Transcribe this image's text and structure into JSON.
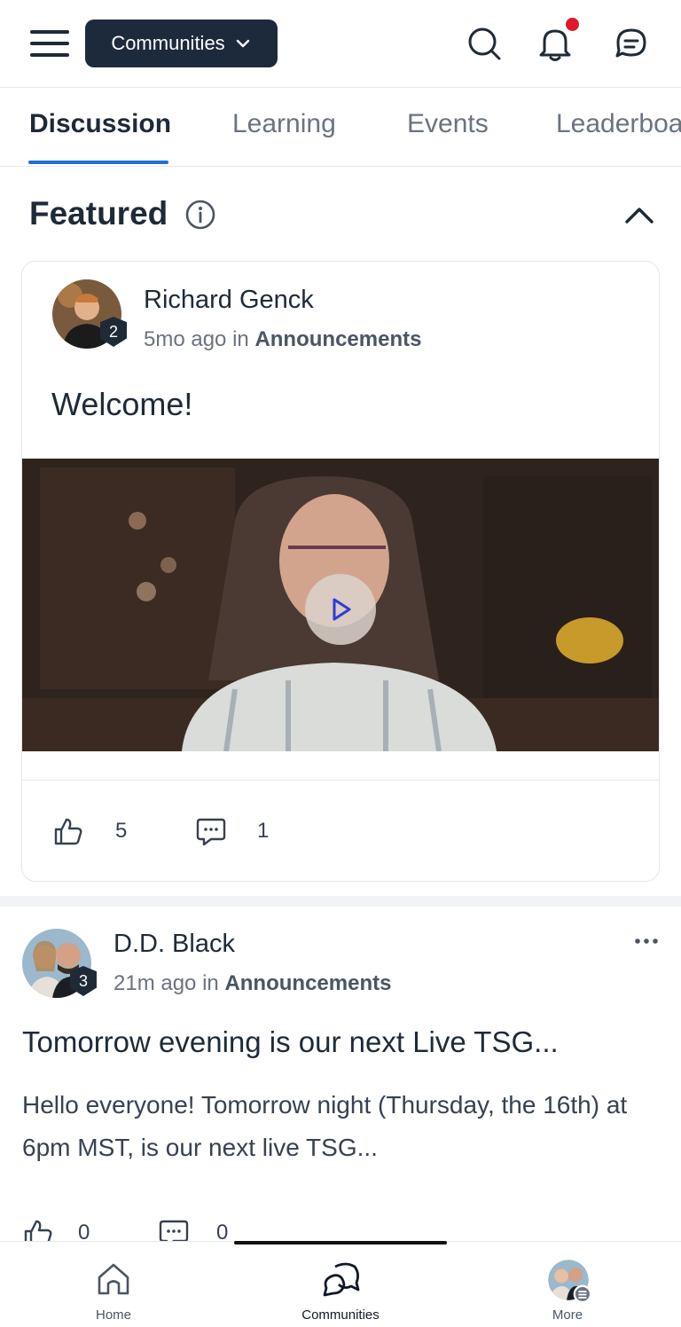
{
  "header": {
    "community_label": "Communities",
    "icons": [
      "menu-icon",
      "search-icon",
      "bell-icon",
      "chat-icon"
    ],
    "notification_dot_color": "#e0182d"
  },
  "tabs": [
    {
      "label": "Discussion",
      "active": true
    },
    {
      "label": "Learning",
      "active": false
    },
    {
      "label": "Events",
      "active": false
    },
    {
      "label": "Leaderboa",
      "active": false
    }
  ],
  "featured": {
    "title": "Featured",
    "post": {
      "author": "Richard Genck",
      "level": "2",
      "time": "5mo ago",
      "in_word": "in",
      "category": "Announcements",
      "title": "Welcome!",
      "likes": "5",
      "comments": "1"
    }
  },
  "feed": [
    {
      "author": "D.D. Black",
      "level": "3",
      "time": "21m ago",
      "in_word": "in",
      "category": "Announcements",
      "title": "Tomorrow evening is our next Live TSG...",
      "body": "Hello everyone! Tomorrow night (Thursday, the 16th) at 6pm MST, is our next live TSG...",
      "likes": "0",
      "comments": "0"
    }
  ],
  "bottom_nav": [
    {
      "label": "Home",
      "icon": "home-icon"
    },
    {
      "label": "Communities",
      "icon": "communities-icon"
    },
    {
      "label": "More",
      "icon": "profile-avatar"
    }
  ],
  "colors": {
    "accent": "#1f6fd6",
    "dark_button": "#1d2a3c"
  }
}
